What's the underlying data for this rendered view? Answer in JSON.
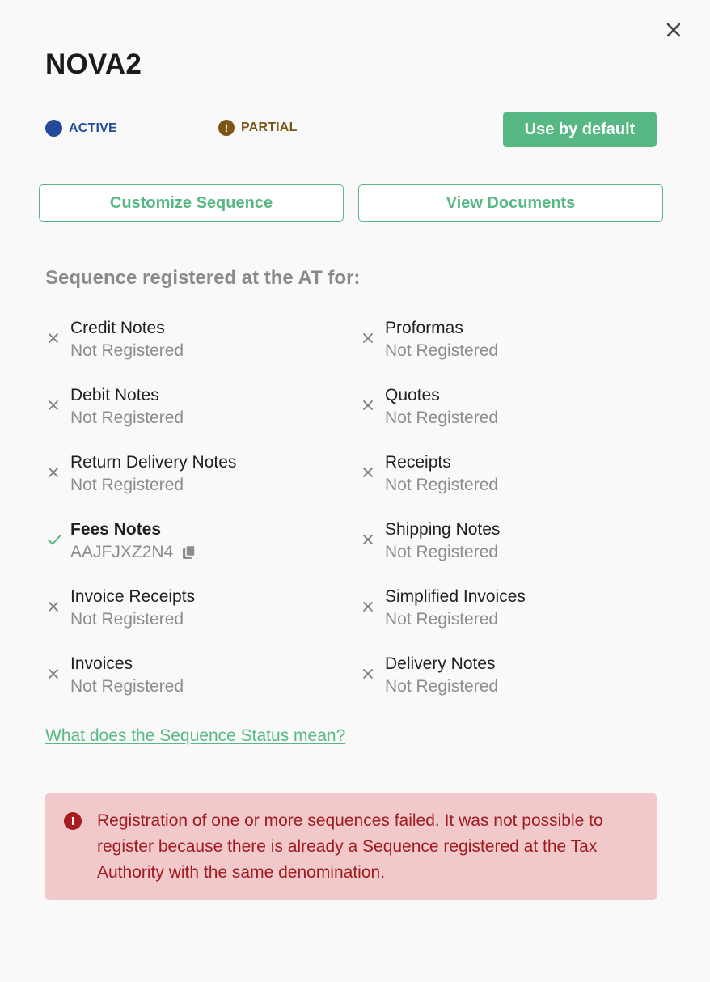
{
  "title": "NOVA2",
  "statuses": {
    "active": "ACTIVE",
    "partial": "PARTIAL"
  },
  "buttons": {
    "use_default": "Use by default",
    "customize": "Customize Sequence",
    "view_documents": "View Documents"
  },
  "section_title": "Sequence registered at the AT for:",
  "documents": [
    {
      "name": "Credit Notes",
      "status": "Not Registered",
      "registered": false
    },
    {
      "name": "Proformas",
      "status": "Not Registered",
      "registered": false
    },
    {
      "name": "Debit Notes",
      "status": "Not Registered",
      "registered": false
    },
    {
      "name": "Quotes",
      "status": "Not Registered",
      "registered": false
    },
    {
      "name": "Return Delivery Notes",
      "status": "Not Registered",
      "registered": false
    },
    {
      "name": "Receipts",
      "status": "Not Registered",
      "registered": false
    },
    {
      "name": "Fees Notes",
      "status": "AAJFJXZ2N4",
      "registered": true
    },
    {
      "name": "Shipping Notes",
      "status": "Not Registered",
      "registered": false
    },
    {
      "name": "Invoice Receipts",
      "status": "Not Registered",
      "registered": false
    },
    {
      "name": "Simplified Invoices",
      "status": "Not Registered",
      "registered": false
    },
    {
      "name": "Invoices",
      "status": "Not Registered",
      "registered": false
    },
    {
      "name": "Delivery Notes",
      "status": "Not Registered",
      "registered": false
    }
  ],
  "help_link": "What does the Sequence Status mean?",
  "alert": {
    "message": "Registration of one or more sequences failed. It was not possible to register because there is already a Sequence registered at the Tax Authority with the same denomination."
  },
  "icons": {
    "close": "close-icon",
    "active": "status-dot-icon",
    "partial": "exclamation-icon",
    "not_registered": "x-icon",
    "registered": "check-icon",
    "copy": "copy-icon",
    "alert": "error-icon"
  },
  "colors": {
    "accent": "#57b883",
    "active": "#264a9a",
    "partial": "#7a5516",
    "alert_bg": "#f2c9cb",
    "alert_text": "#a01b1f"
  }
}
